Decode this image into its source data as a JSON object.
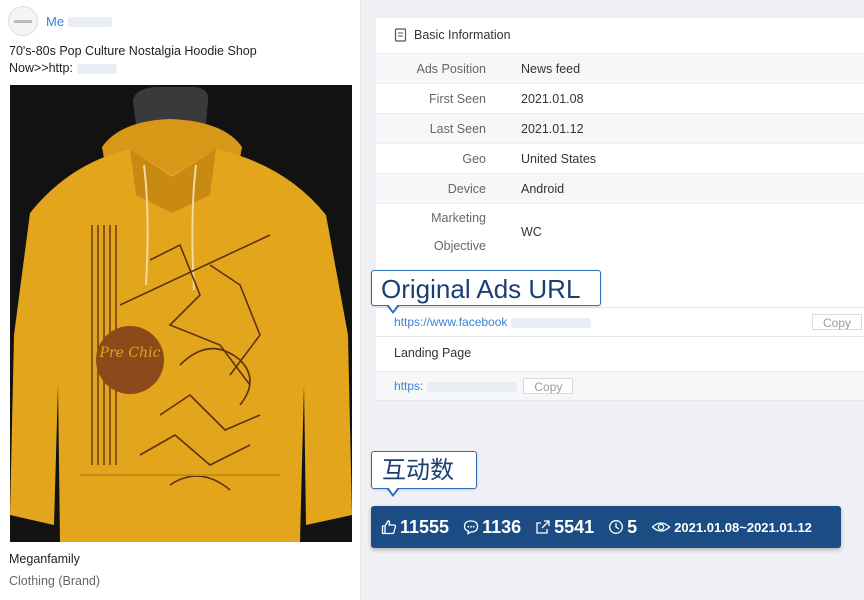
{
  "ad": {
    "page_name": "Me",
    "text_line1": "70's-80s Pop Culture Nostalgia Hoodie Shop",
    "text_line2": "Now>>http:",
    "advertiser": "Meganfamily",
    "category": "Clothing (Brand)"
  },
  "basic_info": {
    "title": "Basic Information",
    "rows": [
      {
        "label": "Ads Position",
        "value": "News feed"
      },
      {
        "label": "First Seen",
        "value": "2021.01.08"
      },
      {
        "label": "Last Seen",
        "value": "2021.01.12"
      },
      {
        "label": "Geo",
        "value": "United States"
      },
      {
        "label": "Device",
        "value": "Android"
      },
      {
        "label_line1": "Marketing",
        "label_line2": "Objective",
        "value": "WC"
      }
    ]
  },
  "urls": {
    "original_url": "https://www.facebook",
    "copy_label": "Copy",
    "landing_title": "Landing Page",
    "landing_url": "https:"
  },
  "callouts": {
    "original_ads_url": "Original Ads URL",
    "interactions": "互动数"
  },
  "stats": {
    "likes": "11555",
    "comments": "1136",
    "shares": "5541",
    "days": "5",
    "date_range": "2021.01.08~2021.01.12"
  },
  "colors": {
    "link_blue": "#3b82d6",
    "stats_bar": "#1b4d84",
    "callout_border": "#2e6fb8",
    "hoodie_yellow": "#e3a51c"
  },
  "icons": [
    "doc-icon",
    "thumbs-up-icon",
    "comment-icon",
    "share-icon",
    "clock-icon",
    "eye-icon"
  ]
}
